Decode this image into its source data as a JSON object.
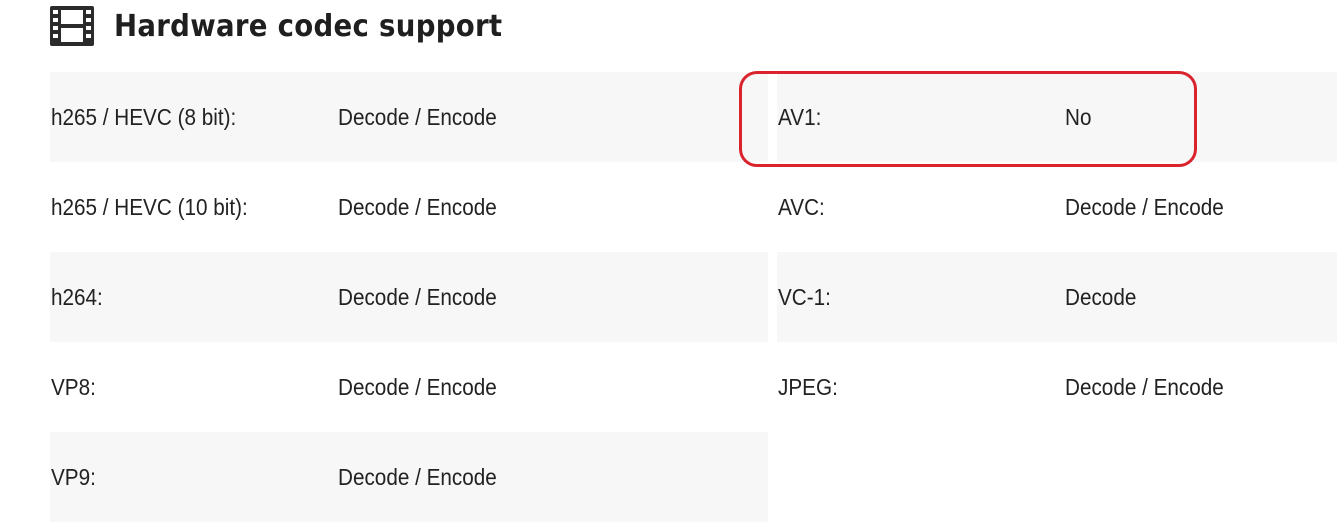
{
  "header": {
    "title": "Hardware codec support",
    "icon": "film-strip-icon"
  },
  "rows": [
    {
      "shaded": true,
      "left": {
        "label": "h265 / HEVC (8 bit):",
        "value": "Decode / Encode"
      },
      "right": {
        "label": "AV1:",
        "value": "No"
      }
    },
    {
      "shaded": false,
      "left": {
        "label": "h265 / HEVC (10 bit):",
        "value": "Decode / Encode"
      },
      "right": {
        "label": "AVC:",
        "value": "Decode / Encode"
      }
    },
    {
      "shaded": true,
      "left": {
        "label": "h264:",
        "value": "Decode / Encode"
      },
      "right": {
        "label": "VC-1:",
        "value": "Decode"
      }
    },
    {
      "shaded": false,
      "left": {
        "label": "VP8:",
        "value": "Decode / Encode"
      },
      "right": {
        "label": "JPEG:",
        "value": "Decode / Encode"
      }
    },
    {
      "shaded": true,
      "left": {
        "label": "VP9:",
        "value": "Decode / Encode"
      },
      "right": null
    }
  ],
  "colors": {
    "row_shade": "#f7f7f7",
    "highlight_border": "#d9232d",
    "text": "#222222"
  }
}
